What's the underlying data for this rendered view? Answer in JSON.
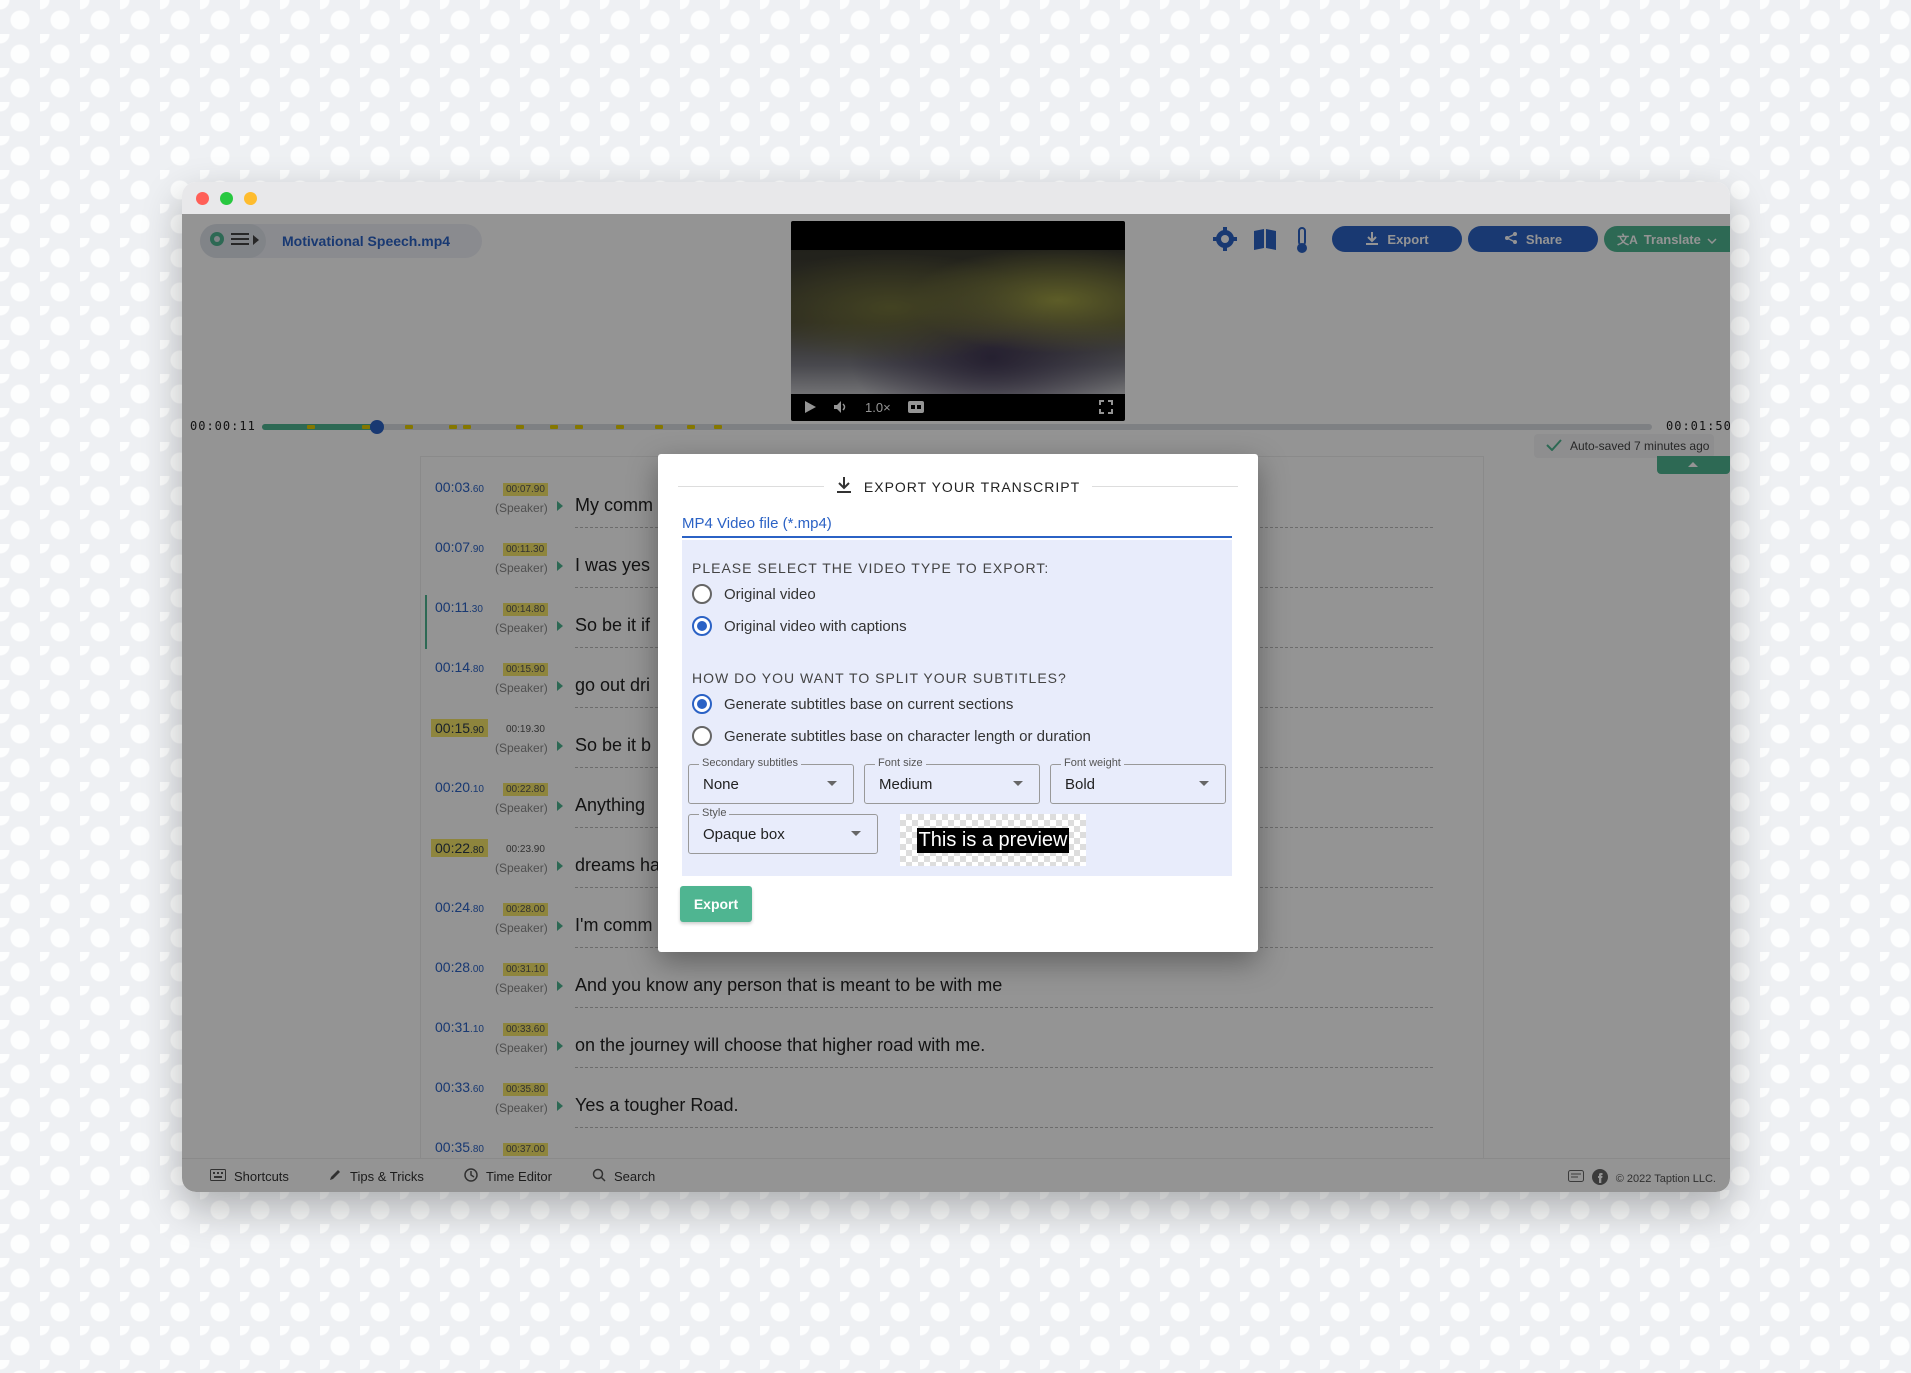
{
  "app": {
    "file_name": "Motivational Speech.mp4",
    "autosave": "Auto-saved 7 minutes ago",
    "time_current": "00:00:11",
    "time_total": "00:01:50",
    "progress_fraction": 0.083,
    "copyright": "© 2022 Taption LLC.",
    "accent_blue": "#2b62c5",
    "accent_green": "#4fb591",
    "highlight_yellow": "#f5e66a"
  },
  "video": {
    "speed": "1.0×",
    "icons": [
      "play-icon",
      "volume-icon",
      "captions-icon",
      "fullscreen-icon"
    ]
  },
  "toolbar": {
    "export_label": "Export",
    "share_label": "Share",
    "translate_label": "Translate",
    "icons": [
      "gear-icon",
      "book-icon",
      "thermometer-icon"
    ]
  },
  "transcript": [
    {
      "start": "00:03",
      "start_ms": ".60",
      "end": "00:07.90",
      "speaker": "(Speaker)",
      "text": "My comm",
      "start_hl": false,
      "end_hl": true
    },
    {
      "start": "00:07",
      "start_ms": ".90",
      "end": "00:11.30",
      "speaker": "(Speaker)",
      "text": "I was yes",
      "start_hl": false,
      "end_hl": true
    },
    {
      "start": "00:11",
      "start_ms": ".30",
      "end": "00:14.80",
      "speaker": "(Speaker)",
      "text": "So be it if",
      "start_hl": false,
      "end_hl": true,
      "active": true
    },
    {
      "start": "00:14",
      "start_ms": ".80",
      "end": "00:15.90",
      "speaker": "(Speaker)",
      "text": "go out dri",
      "start_hl": false,
      "end_hl": true
    },
    {
      "start": "00:15",
      "start_ms": ".90",
      "end": "00:19.30",
      "speaker": "(Speaker)",
      "text": "So be it b",
      "start_hl": true,
      "end_hl": false
    },
    {
      "start": "00:20",
      "start_ms": ".10",
      "end": "00:22.80",
      "speaker": "(Speaker)",
      "text": "Anything",
      "start_hl": false,
      "end_hl": true
    },
    {
      "start": "00:22",
      "start_ms": ".80",
      "end": "00:23.90",
      "speaker": "(Speaker)",
      "text": "dreams ha",
      "start_hl": true,
      "end_hl": false
    },
    {
      "start": "00:24",
      "start_ms": ".80",
      "end": "00:28.00",
      "speaker": "(Speaker)",
      "text": "I'm comm",
      "start_hl": false,
      "end_hl": true
    },
    {
      "start": "00:28",
      "start_ms": ".00",
      "end": "00:31.10",
      "speaker": "(Speaker)",
      "text": "And you know any person that is meant to be with me",
      "start_hl": false,
      "end_hl": true
    },
    {
      "start": "00:31",
      "start_ms": ".10",
      "end": "00:33.60",
      "speaker": "(Speaker)",
      "text": "on the journey will choose that higher road with me.",
      "start_hl": false,
      "end_hl": true
    },
    {
      "start": "00:33",
      "start_ms": ".60",
      "end": "00:35.80",
      "speaker": "(Speaker)",
      "text": "Yes a tougher Road.",
      "start_hl": false,
      "end_hl": true
    },
    {
      "start": "00:35",
      "start_ms": ".80",
      "end": "00:37.00",
      "speaker": "(Speaker)",
      "text": "",
      "start_hl": false,
      "end_hl": true
    }
  ],
  "footer": {
    "shortcuts": "Shortcuts",
    "tips": "Tips & Tricks",
    "time_editor": "Time Editor",
    "search": "Search"
  },
  "modal": {
    "title": "EXPORT YOUR TRANSCRIPT",
    "format": "MP4 Video file (*.mp4)",
    "video_type_heading": "PLEASE SELECT THE VIDEO TYPE TO EXPORT:",
    "video_type_options": [
      {
        "label": "Original video",
        "selected": false
      },
      {
        "label": "Original video with captions",
        "selected": true
      }
    ],
    "split_heading": "HOW DO YOU WANT TO SPLIT YOUR SUBTITLES?",
    "split_options": [
      {
        "label": "Generate subtitles base on current sections",
        "selected": true
      },
      {
        "label": "Generate subtitles base on character length or duration",
        "selected": false
      }
    ],
    "secondary_label": "Secondary subtitles",
    "secondary_value": "None",
    "font_size_label": "Font size",
    "font_size_value": "Medium",
    "font_weight_label": "Font weight",
    "font_weight_value": "Bold",
    "style_label": "Style",
    "style_value": "Opaque box",
    "preview_text": "This is a preview",
    "export_label": "Export"
  }
}
